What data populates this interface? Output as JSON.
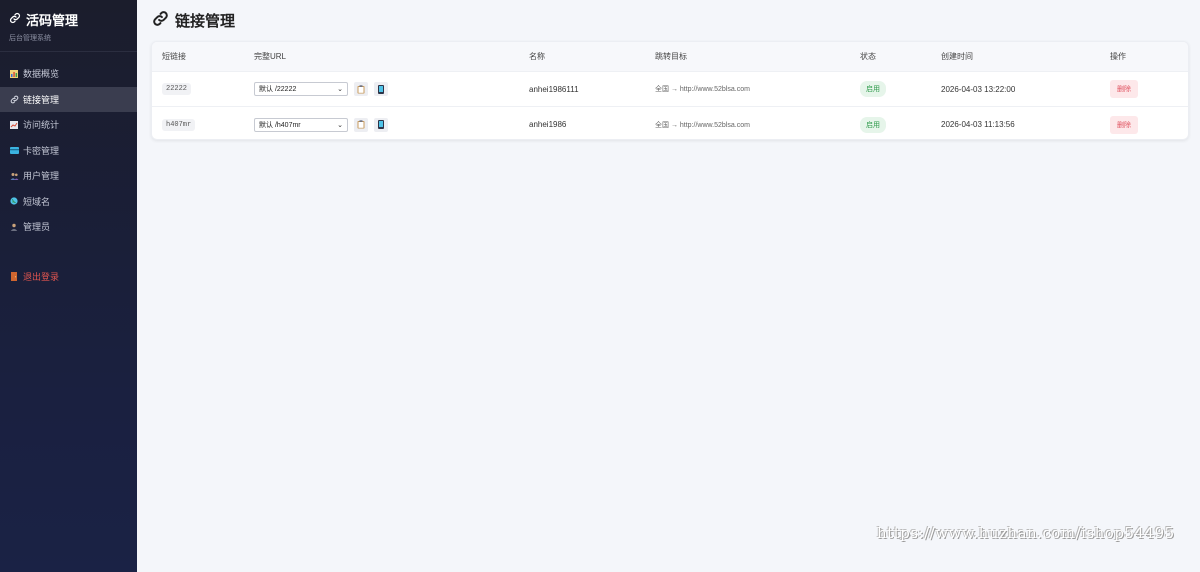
{
  "sidebar": {
    "title": "活码管理",
    "subtitle": "后台管理系统",
    "items": [
      {
        "label": "数据概览",
        "icon": "chart-icon",
        "active": false
      },
      {
        "label": "链接管理",
        "icon": "link-icon",
        "active": true
      },
      {
        "label": "访问统计",
        "icon": "stats-icon",
        "active": false
      },
      {
        "label": "卡密管理",
        "icon": "card-icon",
        "active": false
      },
      {
        "label": "用户管理",
        "icon": "users-icon",
        "active": false
      },
      {
        "label": "短域名",
        "icon": "globe-icon",
        "active": false
      },
      {
        "label": "管理员",
        "icon": "admin-icon",
        "active": false
      }
    ],
    "logout": "退出登录"
  },
  "page": {
    "title": "链接管理"
  },
  "table": {
    "headers": [
      "短链接",
      "完整URL",
      "名称",
      "跳转目标",
      "状态",
      "创建时间",
      "操作"
    ],
    "rows": [
      {
        "code": "22222",
        "url": "默认 /22222",
        "name": "anhei1986111",
        "target": "全国 → http://www.52blsa.com",
        "status": "启用",
        "created": "2026-04-03 13:22:00",
        "action": "删除"
      },
      {
        "code": "h407mr",
        "url": "默认 /h407mr",
        "name": "anhei1986",
        "target": "全国 → http://www.52blsa.com",
        "status": "启用",
        "created": "2026-04-03 11:13:56",
        "action": "删除"
      }
    ]
  },
  "watermark": "https://www.huzhan.com/ishop54495",
  "colors": {
    "sidebar_bg": "#1b1d2c",
    "active_bg": "#3a3d4f",
    "logout": "#e0554f",
    "status_green": "#2e9a4a",
    "delete_red": "#e05360"
  }
}
